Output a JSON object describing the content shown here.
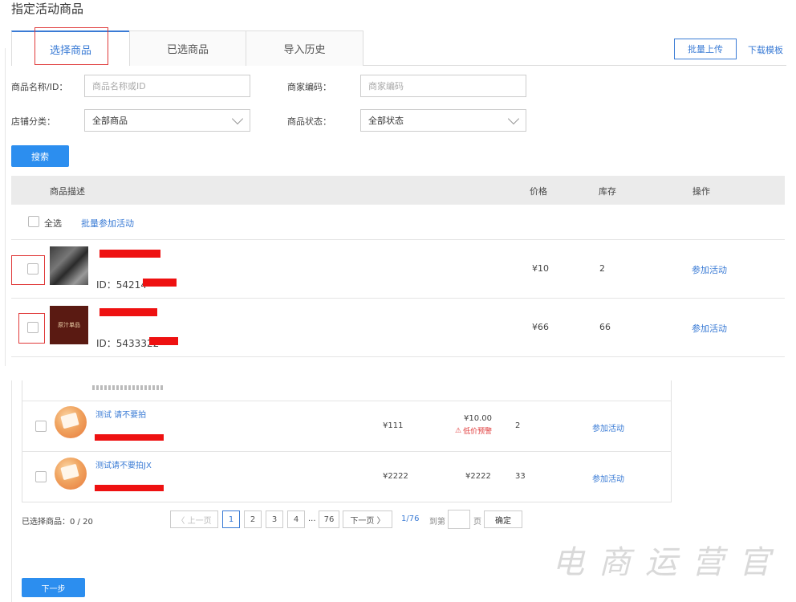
{
  "page_title": "指定活动商品",
  "tabs": [
    {
      "label": "选择商品",
      "active": true
    },
    {
      "label": "已选商品",
      "active": false
    },
    {
      "label": "导入历史",
      "active": false
    }
  ],
  "toolbar": {
    "batch_upload": "批量上传",
    "download_template": "下载模板"
  },
  "filters": {
    "name_label": "商品名称/ID：",
    "name_placeholder": "商品名称或ID",
    "code_label": "商家编码：",
    "code_placeholder": "商家编码",
    "category_label": "店铺分类：",
    "category_value": "全部商品",
    "status_label": "商品状态：",
    "status_value": "全部状态",
    "search_button": "搜索"
  },
  "table": {
    "headers": {
      "desc": "商品描述",
      "price": "价格",
      "stock": "库存",
      "action": "操作"
    },
    "select_all": "全选",
    "batch_join": "批量参加活动",
    "rows": [
      {
        "id_prefix": "ID：54214",
        "price": "¥10",
        "stock": "2",
        "action": "参加活动"
      },
      {
        "id_prefix": "ID：5433322",
        "price": "¥66",
        "stock": "66",
        "action": "参加活动",
        "thumb_text": "原汁单品"
      }
    ]
  },
  "lower_table": {
    "rows": [
      {
        "name": "测试 请不要拍",
        "price": "¥111",
        "promo_price": "¥10.00",
        "warning": "低价预警",
        "stock": "2",
        "action": "参加活动"
      },
      {
        "name": "测试请不要拍JX",
        "price": "¥2222",
        "promo_price": "¥2222",
        "stock": "33",
        "action": "参加活动"
      }
    ],
    "selected_count": "已选择商品：0 / 20"
  },
  "pagination": {
    "prev": "〈 上一页",
    "pages": [
      "1",
      "2",
      "3",
      "4",
      "...",
      "76"
    ],
    "next": "下一页 〉",
    "current_of_total": "1/76",
    "goto_label": "到第",
    "page_unit": "页",
    "confirm": "确定"
  },
  "next_step": "下一步",
  "watermark": "电商运营官",
  "colors": {
    "accent": "#3a7bd5",
    "primary_button": "#2c8eef",
    "highlight_box": "#e03a3a",
    "redaction": "#ee1111"
  }
}
